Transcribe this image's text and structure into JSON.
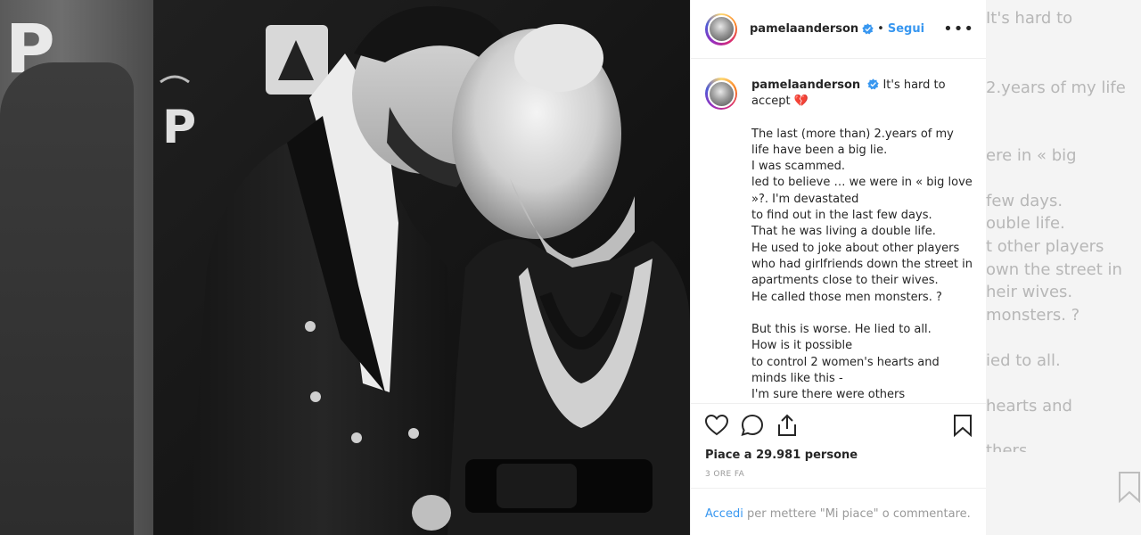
{
  "background": {
    "left_letters": "P",
    "right_lines": [
      "It's hard to",
      "2.years of my life",
      "ere in « big",
      "few days.",
      "ouble life.",
      "t other players",
      "own the street in",
      "heir wives.",
      "monsters. ?",
      "ied to all.",
      "hearts and",
      "thers"
    ]
  },
  "header": {
    "username": "pamelaanderson",
    "separator": "•",
    "follow_label": "Segui",
    "more_label": "•••"
  },
  "caption": {
    "username": "pamelaanderson",
    "headline": "It's hard to accept 💔",
    "body": "The last (more than) 2.years of my life have been a big lie.\nI was scammed.\nled to believe … we were in « big love »?. I'm devastated\nto find out in the last few days.\nThat he was living a double life.\nHe used to joke about other players who had girlfriends down the street in apartments close to their wives.\nHe called those men monsters. ?\n\nBut this is worse. He lied to all.\nHow is it possible\nto control 2 women's hearts and minds like this -\nI'm sure there were others"
  },
  "actions": {
    "likes_text": "Piace a 29.981 persone",
    "time_text": "3 ore fa"
  },
  "login": {
    "link_label": "Accedi",
    "rest_text": " per mettere \"Mi piace\" o commentare."
  },
  "colors": {
    "accent": "#3897f0",
    "text": "#262626",
    "muted": "#999999",
    "border": "#efefef"
  }
}
